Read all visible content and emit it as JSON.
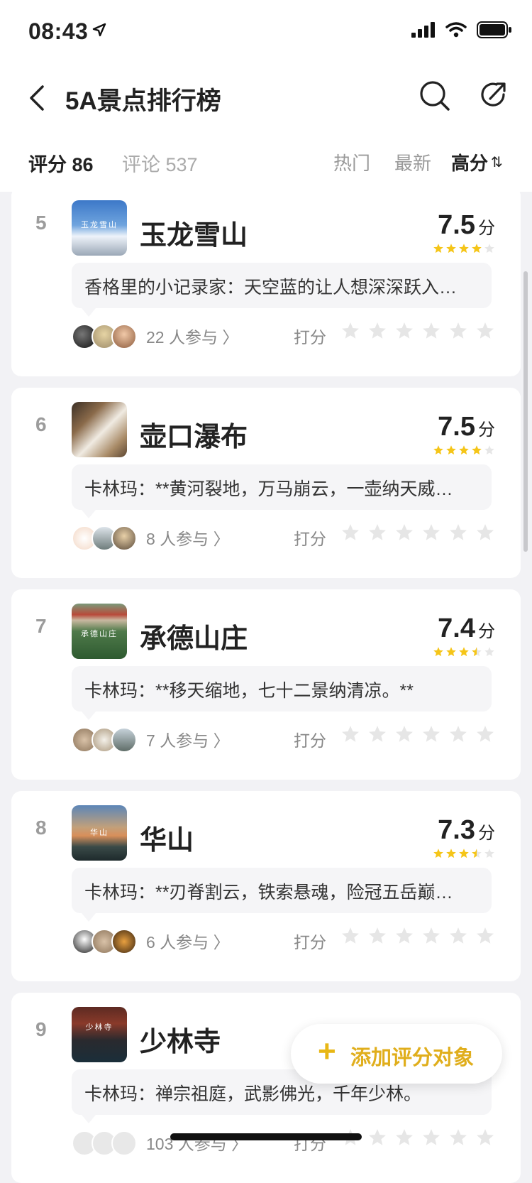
{
  "status_bar": {
    "time": "08:43"
  },
  "header": {
    "title": "5A景点排行榜"
  },
  "tabs": {
    "score": "评分 86",
    "comments": "评论 537"
  },
  "sort": {
    "hot": "热门",
    "newest": "最新",
    "high": "高分",
    "high_icon": "⇅"
  },
  "rate_label": "打分",
  "items": [
    {
      "rank": "5",
      "name": "玉龙雪山",
      "score": "7.5",
      "unit": "分",
      "stars": 4,
      "comment": "香格里的小记录家：天空蓝的让人想深深跃入…",
      "participants": "22 人参与 〉",
      "thumb_text": "玉龙雪山"
    },
    {
      "rank": "6",
      "name": "壶口瀑布",
      "score": "7.5",
      "unit": "分",
      "stars": 4,
      "comment": "卡林玛：**黄河裂地，万马崩云，一壶纳天威…",
      "participants": "8 人参与 〉",
      "thumb_text": ""
    },
    {
      "rank": "7",
      "name": "承德山庄",
      "score": "7.4",
      "unit": "分",
      "stars": 3.5,
      "comment": "卡林玛：**移天缩地，七十二景纳清凉。**",
      "participants": "7 人参与 〉",
      "thumb_text": "承德山庄"
    },
    {
      "rank": "8",
      "name": "华山",
      "score": "7.3",
      "unit": "分",
      "stars": 3.5,
      "comment": "卡林玛：**刃脊割云，铁索悬魂，险冠五岳巅…",
      "participants": "6 人参与 〉",
      "thumb_text": "华山"
    },
    {
      "rank": "9",
      "name": "少林寺",
      "score": "",
      "unit": "",
      "stars": 0,
      "comment": "卡林玛：禅宗祖庭，武影佛光，千年少林。",
      "participants": "103 人参与 〉",
      "thumb_text": "少林寺"
    }
  ],
  "fab": {
    "plus": "+",
    "label": "添加评分对象"
  },
  "colors": {
    "star_gold": "#f5c518",
    "star_empty": "#e6e6e6",
    "accent": "#e0ae1c"
  },
  "icons": [
    "back-icon",
    "search-icon",
    "share-icon",
    "signal-icon",
    "wifi-icon",
    "battery-icon",
    "location-arrow-icon",
    "star-icon",
    "plus-icon"
  ]
}
